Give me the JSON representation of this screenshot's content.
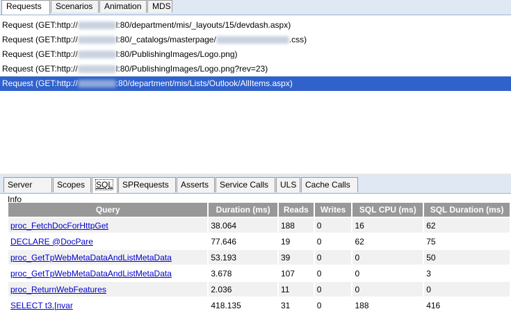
{
  "top_tabs": [
    "Requests",
    "Scenarios",
    "Animation",
    "MDS"
  ],
  "requests": [
    {
      "prefix": "Request (GET:http://",
      "middle": "l:80/department/mis/_layouts/15/devdash.aspx)",
      "suffix": ""
    },
    {
      "prefix": "Request (GET:http://",
      "middle": "l:80/_catalogs/masterpage/",
      "suffix": ".css)"
    },
    {
      "prefix": "Request (GET:http://",
      "middle": "l:80/PublishingImages/Logo.png)",
      "suffix": ""
    },
    {
      "prefix": "Request (GET:http://",
      "middle": "l:80/PublishingImages/Logo.png?rev=23)",
      "suffix": ""
    },
    {
      "prefix": "Request (GET:http://",
      "middle": ":80/department/mis/Lists/Outlook/AllItems.aspx)",
      "suffix": ""
    }
  ],
  "bottom_tabs": [
    "Server Info",
    "Scopes",
    "SQL",
    "SPRequests",
    "Asserts",
    "Service Calls",
    "ULS",
    "Cache Calls"
  ],
  "table": {
    "headers": [
      "Query",
      "Duration (ms)",
      "Reads",
      "Writes",
      "SQL CPU (ms)",
      "SQL Duration (ms)"
    ],
    "rows": [
      [
        "proc_FetchDocForHttpGet",
        "38.064",
        "188",
        "0",
        "16",
        "62"
      ],
      [
        "DECLARE @DocPare",
        "77.646",
        "19",
        "0",
        "62",
        "75"
      ],
      [
        "proc_GetTpWebMetaDataAndListMetaData",
        "53.193",
        "39",
        "0",
        "0",
        "50"
      ],
      [
        "proc_GetTpWebMetaDataAndListMetaData",
        "3.678",
        "107",
        "0",
        "0",
        "3"
      ],
      [
        "proc_ReturnWebFeatures",
        "2.036",
        "11",
        "0",
        "0",
        "0"
      ],
      [
        "SELECT t3.[nvar",
        "418.135",
        "31",
        "0",
        "188",
        "416"
      ]
    ]
  },
  "colors": {
    "selection": "#3162cc",
    "header": "#989898",
    "link": "#0000cc"
  }
}
